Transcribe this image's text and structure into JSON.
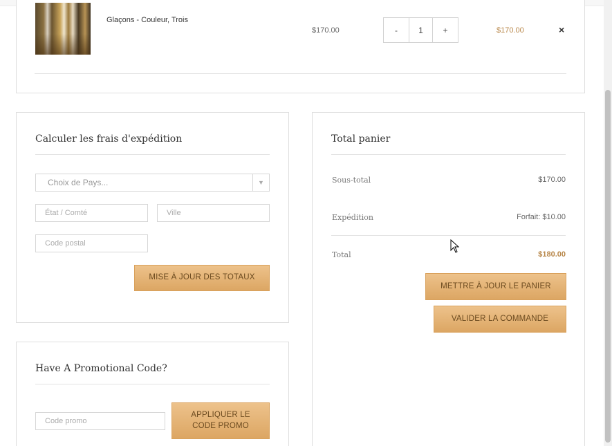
{
  "cart_item": {
    "name": "Glaçons - Couleur, Trois",
    "price": "$170.00",
    "qty_minus": "-",
    "quantity": "1",
    "qty_plus": "+",
    "subtotal": "$170.00",
    "remove": "×"
  },
  "shipping": {
    "title": "Calculer les frais d'expédition",
    "country_placeholder": "Choix de Pays...",
    "state_placeholder": "État / Comté",
    "city_placeholder": "Ville",
    "postcode_placeholder": "Code postal",
    "update_button": "MISE À JOUR DES TOTAUX"
  },
  "promo": {
    "title": "Have A Promotional Code?",
    "code_placeholder": "Code promo",
    "apply_button_line1": "APPLIQUER LE",
    "apply_button_line2": "CODE PROMO"
  },
  "totals": {
    "title": "Total panier",
    "subtotal_label": "Sous-total",
    "subtotal_value": "$170.00",
    "shipping_label": "Expédition",
    "shipping_value": "Forfait: $10.00",
    "total_label": "Total",
    "total_value": "$180.00",
    "update_cart_button": "METTRE À JOUR LE PANIER",
    "checkout_button": "VALIDER LA COMMANDE"
  },
  "colors": {
    "accent": "#b8874a",
    "button_top": "#edc28b",
    "button_bottom": "#dca663"
  }
}
